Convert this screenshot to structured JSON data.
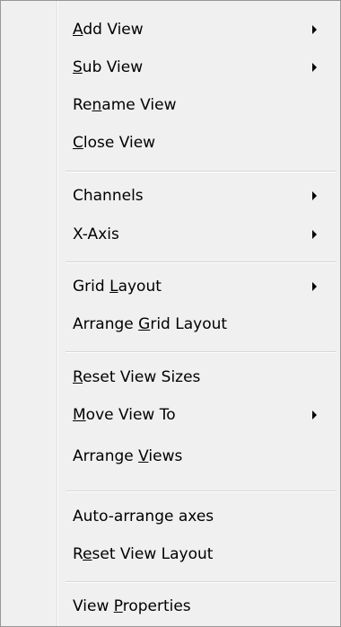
{
  "menu": {
    "items": [
      {
        "pre": "",
        "key": "A",
        "post": "dd View",
        "submenu": true
      },
      {
        "pre": "",
        "key": "S",
        "post": "ub View",
        "submenu": true
      },
      {
        "pre": "Re",
        "key": "n",
        "post": "ame View",
        "submenu": false
      },
      {
        "pre": "",
        "key": "C",
        "post": "lose View",
        "submenu": false
      },
      {
        "pre": "Channels",
        "key": "",
        "post": "",
        "submenu": true
      },
      {
        "pre": "X-Axis",
        "key": "",
        "post": "",
        "submenu": true
      },
      {
        "pre": "Grid ",
        "key": "L",
        "post": "ayout",
        "submenu": true
      },
      {
        "pre": "Arrange ",
        "key": "G",
        "post": "rid Layout",
        "submenu": false
      },
      {
        "pre": "",
        "key": "R",
        "post": "eset View Sizes",
        "submenu": false
      },
      {
        "pre": "",
        "key": "M",
        "post": "ove View To",
        "submenu": true
      },
      {
        "pre": "Arrange ",
        "key": "V",
        "post": "iews",
        "submenu": false
      },
      {
        "pre": "Auto-arrange axes",
        "key": "",
        "post": "",
        "submenu": false
      },
      {
        "pre": "R",
        "key": "e",
        "post": "set View Layout",
        "submenu": false
      },
      {
        "pre": "View ",
        "key": "P",
        "post": "roperties",
        "submenu": false
      }
    ]
  }
}
